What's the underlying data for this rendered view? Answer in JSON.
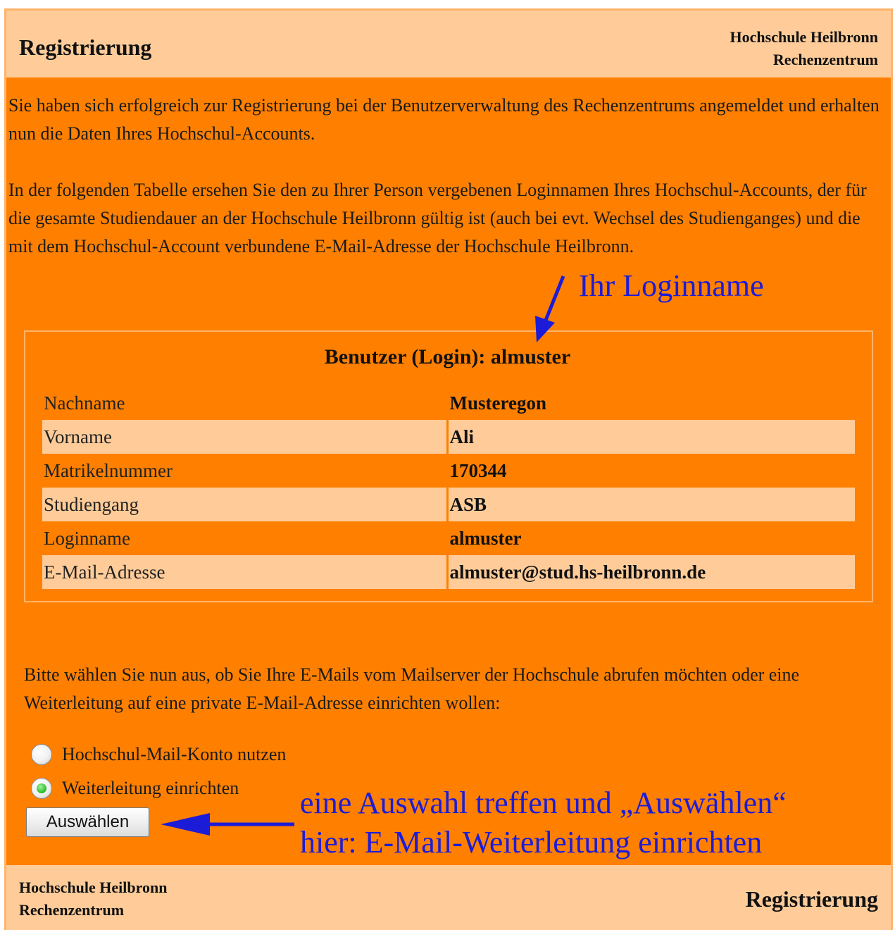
{
  "header": {
    "title": "Registrierung",
    "org_line1": "Hochschule Heilbronn",
    "org_line2": "Rechenzentrum"
  },
  "intro": {
    "paragraph1": "Sie haben sich erfolgreich zur Registrierung bei der Benutzerverwaltung des Rechenzentrums angemeldet und erhalten nun die Daten Ihres Hochschul-Accounts.",
    "paragraph2": "In der folgenden Tabelle ersehen Sie den zu Ihrer Person vergebenen Loginnamen Ihres Hochschul-Accounts, der für die gesamte Studiendauer an der Hochschule Heilbronn gültig ist (auch bei evt. Wechsel des Studienganges) und die mit dem Hochschul-Account verbundene E-Mail-Adresse der Hochschule Heilbronn."
  },
  "annotations": {
    "login_hint": "Ihr Loginname",
    "choice_hint_line1": "eine Auswahl treffen und „Auswählen“",
    "choice_hint_line2": "hier: E-Mail-Weiterleitung einrichten",
    "color": "#1c1cd8"
  },
  "user": {
    "caption": "Benutzer (Login): almuster",
    "rows": [
      {
        "label": "Nachname",
        "value": "Musteregon"
      },
      {
        "label": "Vorname",
        "value": "Ali"
      },
      {
        "label": "Matrikelnummer",
        "value": "170344"
      },
      {
        "label": "Studiengang",
        "value": "ASB"
      },
      {
        "label": "Loginname",
        "value": "almuster"
      },
      {
        "label": "E-Mail-Adresse",
        "value": "almuster@stud.hs-heilbronn.de"
      }
    ]
  },
  "mail_choice": {
    "prompt": "Bitte wählen Sie nun aus, ob Sie Ihre E-Mails vom Mailserver der Hochschule abrufen möchten oder eine Weiterleitung auf eine private E-Mail-Adresse einrichten wollen:",
    "options": [
      {
        "label": "Hochschul-Mail-Konto nutzen",
        "selected": false
      },
      {
        "label": "Weiterleitung einrichten",
        "selected": true
      }
    ],
    "submit_label": "Auswählen"
  },
  "footer": {
    "org_line1": "Hochschule Heilbronn",
    "org_line2": "Rechenzentrum",
    "title": "Registrierung"
  },
  "colors": {
    "page_orange": "#ff8000",
    "band_peach": "#ffcc99",
    "radio_selected": "#29b829"
  }
}
